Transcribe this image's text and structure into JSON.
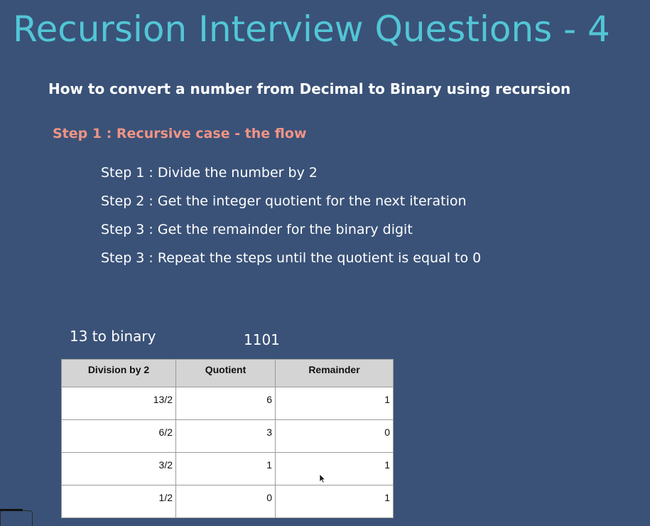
{
  "title": "Recursion Interview Questions - 4",
  "subtitle": "How to convert a number from Decimal to Binary using recursion",
  "step_heading": "Step 1 : Recursive case - the flow",
  "steps": [
    "Step 1 : Divide the number by 2",
    "Step 2 : Get the integer quotient for the next iteration",
    "Step 3 : Get the remainder for the binary digit",
    "Step 3 : Repeat the steps until the quotient is equal to 0"
  ],
  "example": {
    "label": "13  to binary",
    "result": "1101"
  },
  "table": {
    "headers": [
      "Division by 2",
      "Quotient",
      "Remainder"
    ],
    "rows": [
      [
        "13/2",
        "6",
        "1"
      ],
      [
        "6/2",
        "3",
        "0"
      ],
      [
        "3/2",
        "1",
        "1"
      ],
      [
        "1/2",
        "0",
        "1"
      ]
    ]
  },
  "colors": {
    "background": "#3a5278",
    "title": "#52c6d6",
    "step_heading": "#f09484",
    "text": "#ffffff",
    "table_header": "#d4d4d4"
  },
  "icons": {
    "cursor": "mouse-pointer-icon"
  }
}
